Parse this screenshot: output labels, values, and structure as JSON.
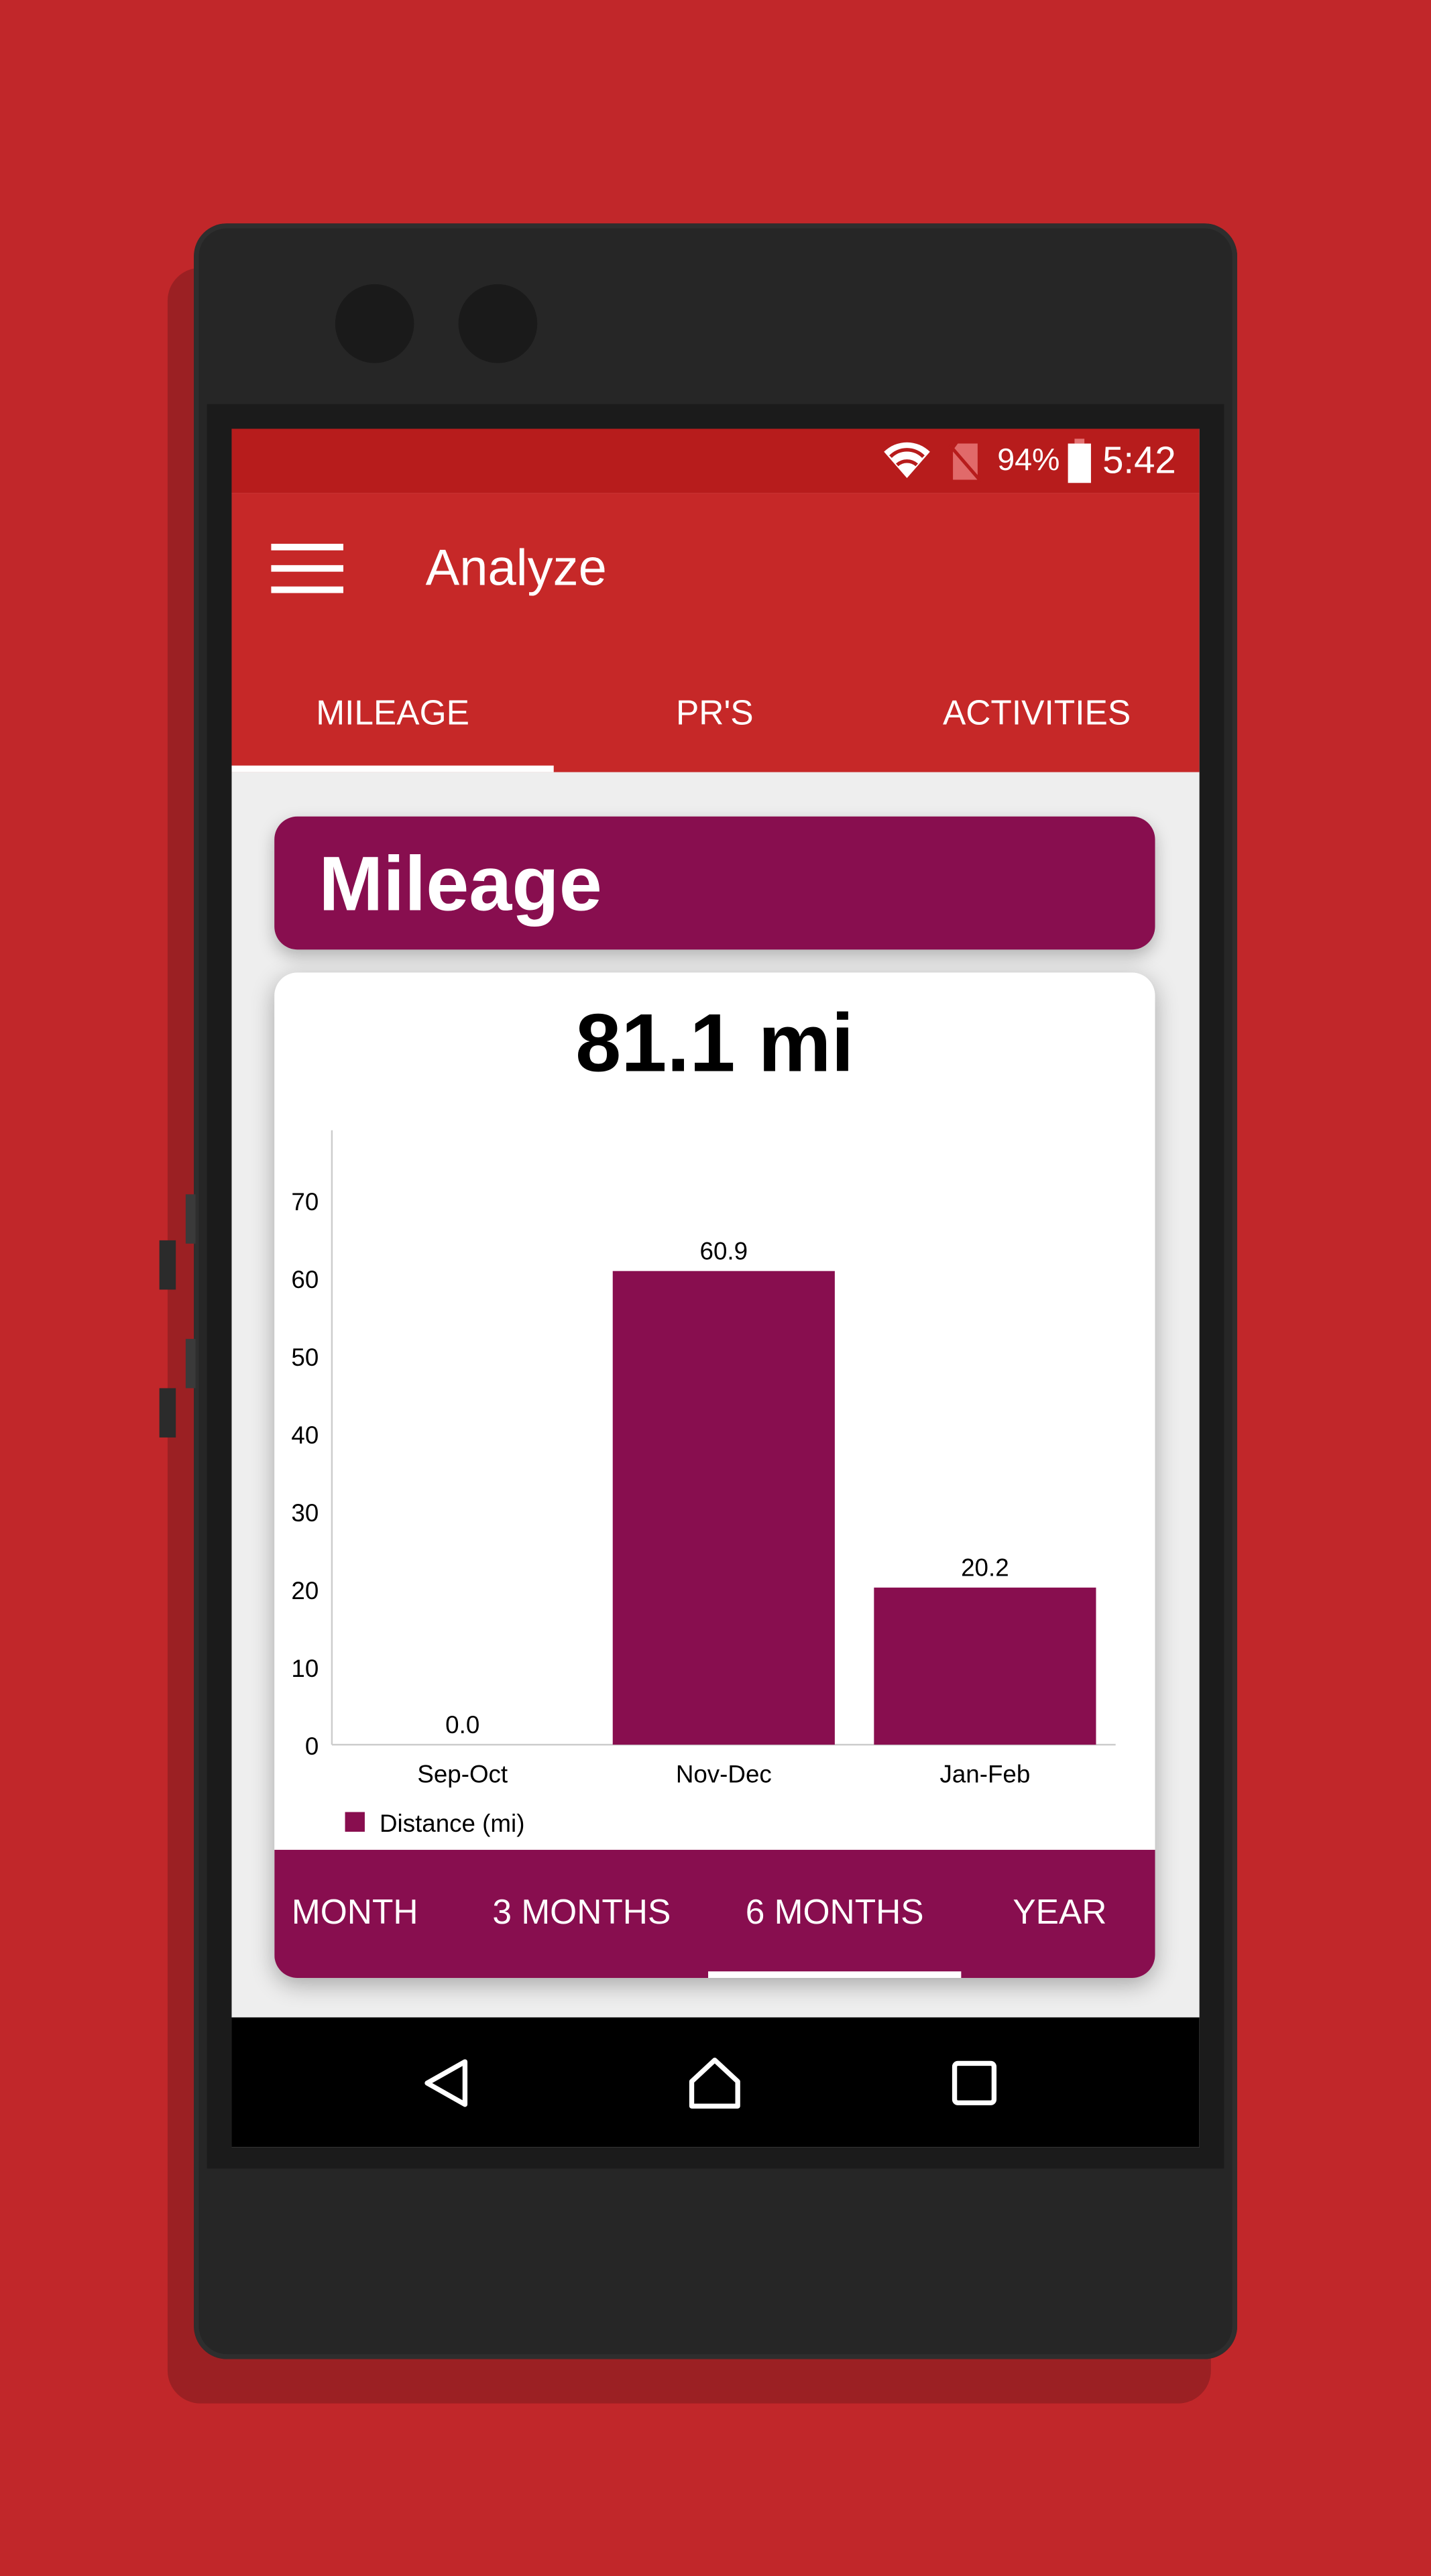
{
  "status_bar": {
    "battery": "94%",
    "time": "5:42",
    "icons": [
      "wifi-icon",
      "no-sim-icon",
      "battery-icon"
    ]
  },
  "toolbar": {
    "title": "Analyze",
    "menu_icon": "hamburger-menu-icon"
  },
  "tabs": [
    {
      "label": "MILEAGE",
      "selected": true
    },
    {
      "label": "PR'S",
      "selected": false
    },
    {
      "label": "ACTIVITIES",
      "selected": false
    }
  ],
  "section": {
    "title": "Mileage"
  },
  "summary": {
    "total": "81.1 mi"
  },
  "range_tabs": [
    {
      "label": "MONTH",
      "selected": false
    },
    {
      "label": "3 MONTHS",
      "selected": false
    },
    {
      "label": "6 MONTHS",
      "selected": true
    },
    {
      "label": "YEAR",
      "selected": false
    }
  ],
  "nav_bar": {
    "icons": [
      "back-icon",
      "home-icon",
      "recents-icon"
    ]
  },
  "colors": {
    "primary": "#C62828",
    "status": "#B71C1C",
    "accent": "#880E4F",
    "background": "#C1272A"
  },
  "chart_data": {
    "type": "bar",
    "categories": [
      "Sep-Oct",
      "Nov-Dec",
      "Jan-Feb"
    ],
    "series": [
      {
        "name": "Distance (mi)",
        "values": [
          0.0,
          60.9,
          20.2
        ],
        "labels": [
          "0.0",
          "60.9",
          "20.2"
        ],
        "color": "#880E4F"
      }
    ],
    "yticks": [
      "0",
      "10",
      "20",
      "30",
      "40",
      "50",
      "60",
      "70"
    ],
    "ylim": [
      0,
      79
    ],
    "grid": false,
    "legend": "bottom-left"
  }
}
